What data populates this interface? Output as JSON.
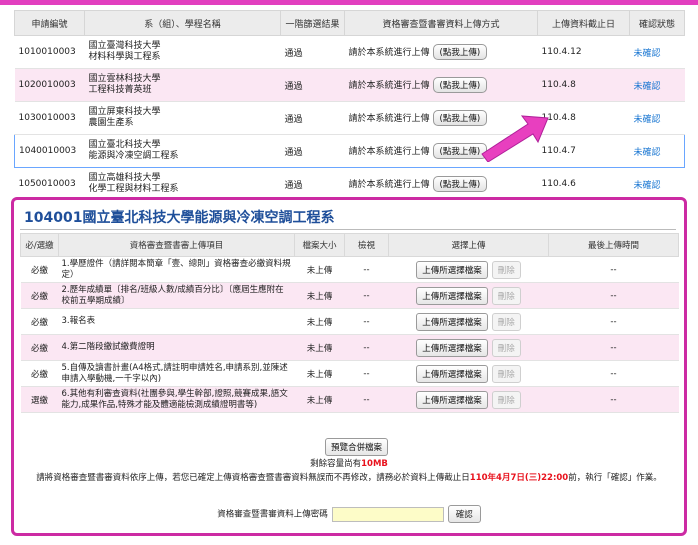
{
  "applications": {
    "headers": [
      "申請編號",
      "系（組）、學程名稱",
      "一階篩選結果",
      "資格審查暨書審資料上傳方式",
      "上傳資料截止日",
      "確認狀態"
    ],
    "rows": [
      {
        "id": "1010010003",
        "school": "國立臺灣科技大學",
        "dept": "材料科學與工程系",
        "result": "通過",
        "method": "請於本系統進行上傳",
        "btn": "(點我上傳)",
        "deadline": "110.4.12",
        "status": "未確認"
      },
      {
        "id": "1020010003",
        "school": "國立雲林科技大學",
        "dept": "工程科技菁英班",
        "result": "通過",
        "method": "請於本系統進行上傳",
        "btn": "(點我上傳)",
        "deadline": "110.4.8",
        "status": "未確認"
      },
      {
        "id": "1030010003",
        "school": "國立屏東科技大學",
        "dept": "農園生產系",
        "result": "通過",
        "method": "請於本系統進行上傳",
        "btn": "(點我上傳)",
        "deadline": "110.4.8",
        "status": "未確認"
      },
      {
        "id": "1040010003",
        "school": "國立臺北科技大學",
        "dept": "能源與冷凍空調工程系",
        "result": "通過",
        "method": "請於本系統進行上傳",
        "btn": "(點我上傳)",
        "deadline": "110.4.7",
        "status": "未確認"
      },
      {
        "id": "1050010003",
        "school": "國立高雄科技大學",
        "dept": "化學工程與材料工程系",
        "result": "通過",
        "method": "請於本系統進行上傳",
        "btn": "(點我上傳)",
        "deadline": "110.4.6",
        "status": "未確認"
      }
    ]
  },
  "panel": {
    "title": "104001國立臺北科技大學能源與冷凍空調工程系",
    "headers": [
      "必/選繳",
      "資格審查暨書審上傳項目",
      "檔案大小",
      "檢視",
      "選擇上傳",
      "最後上傳時間"
    ],
    "rows": [
      {
        "req": "必繳",
        "item": "1.學歷證件（請詳閱本簡章「壹、總則」資格審查必繳資料規定）",
        "size": "未上傳",
        "view": "--",
        "upload": "上傳所選擇檔案",
        "del": "刪除",
        "time": "--"
      },
      {
        "req": "必繳",
        "item": "2.歷年成績單〔排名/班級人數/成績百分比〕〔應屆生應附在校前五學期成績〕",
        "size": "未上傳",
        "view": "--",
        "upload": "上傳所選擇檔案",
        "del": "刪除",
        "time": "--"
      },
      {
        "req": "必繳",
        "item": "3.報名表",
        "size": "未上傳",
        "view": "--",
        "upload": "上傳所選擇檔案",
        "del": "刪除",
        "time": "--"
      },
      {
        "req": "必繳",
        "item": "4.第二階段繳試繳費證明",
        "size": "未上傳",
        "view": "--",
        "upload": "上傳所選擇檔案",
        "del": "刪除",
        "time": "--"
      },
      {
        "req": "必繳",
        "item": "5.自傳及讀書計畫(A4格式,請註明申請姓名,申請系別,並陳述申請入學動機,一千字以內)",
        "size": "未上傳",
        "view": "--",
        "upload": "上傳所選擇檔案",
        "del": "刪除",
        "time": "--"
      },
      {
        "req": "選繳",
        "item": "6.其他有利審查資料(社團參與,學生幹部,證照,競賽成果,語文能力,成果作品,特殊才能及體適能檢測成績證明書等)",
        "size": "未上傳",
        "view": "--",
        "upload": "上傳所選擇檔案",
        "del": "刪除",
        "time": "--"
      }
    ],
    "preview_btn": "預覽合併檔案",
    "remain_prefix": "剩餘容量尚有",
    "remain_value": "10MB",
    "notice_a": "請將資格審查暨書審資料依序上傳，若您已確定上傳資格審查暨書審資料無誤而不再修改，請務必於資料上傳截止日",
    "notice_date": "110年4月7日(三)22:00",
    "notice_b": "前，執行「確認」作業。",
    "pw_label": "資格審查暨書審資料上傳密碼",
    "confirm_btn": "確認"
  },
  "colors": {
    "accent": "#cc2aa3",
    "title": "#1f4f9a",
    "link": "#1976d2",
    "alert": "#e8111c",
    "row_pink": "#fbe7f3"
  }
}
